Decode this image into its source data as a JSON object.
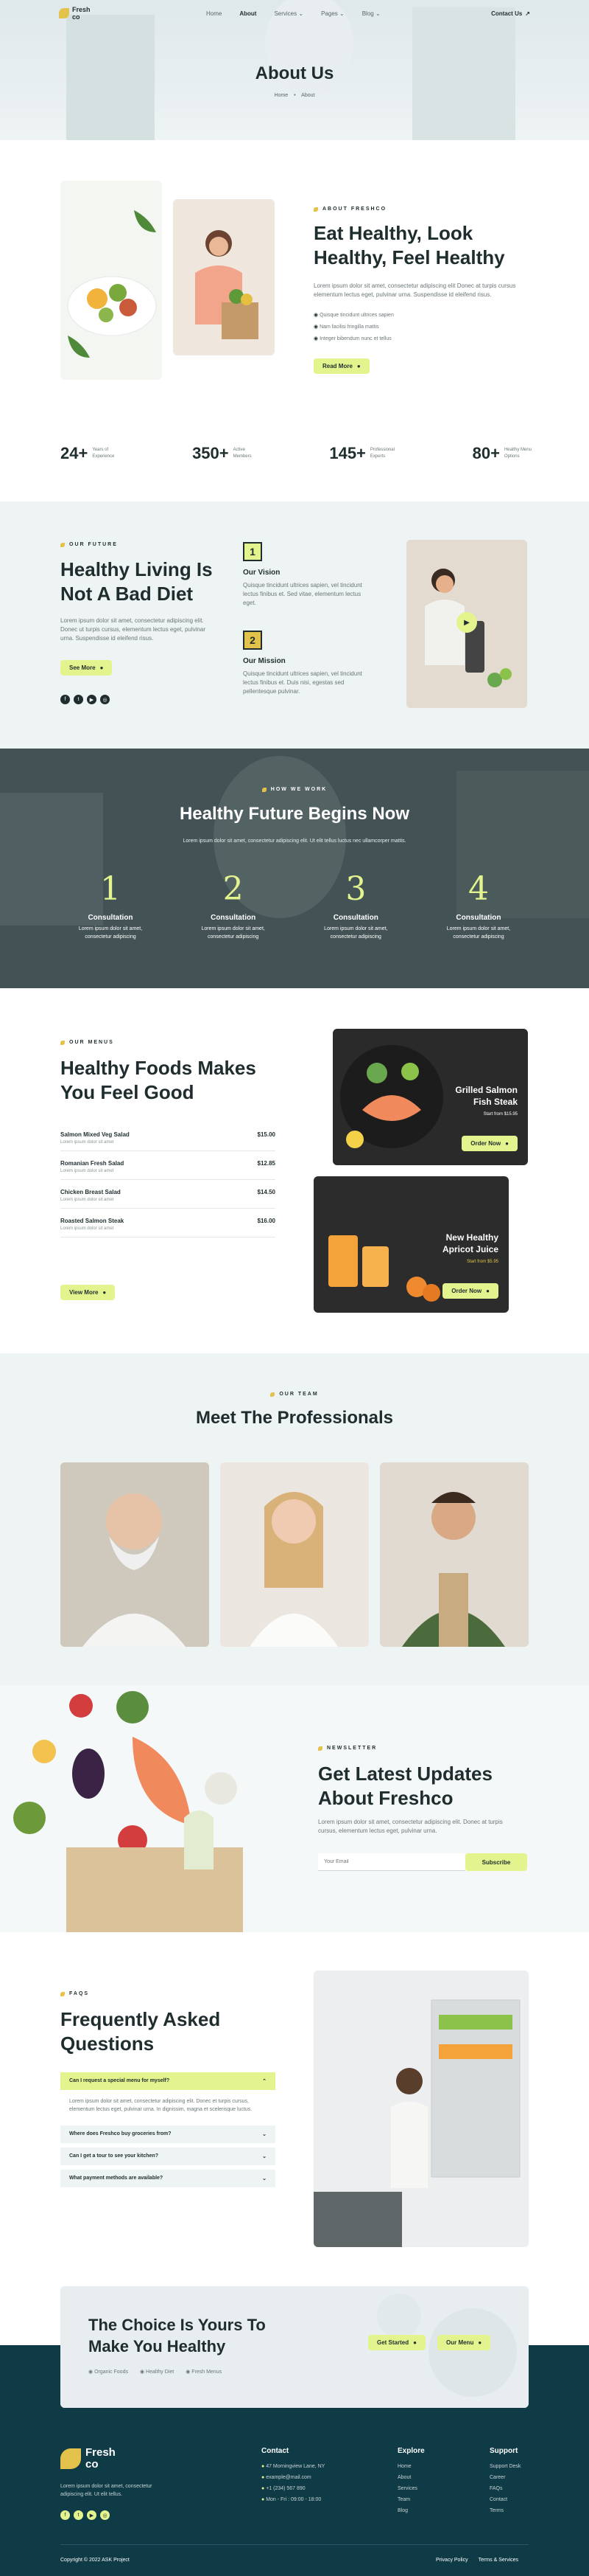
{
  "header": {
    "logo_line1": "Fresh",
    "logo_line2": "co",
    "nav": [
      {
        "label": "Home"
      },
      {
        "label": "About"
      },
      {
        "label": "Services"
      },
      {
        "label": "Pages"
      },
      {
        "label": "Blog"
      }
    ],
    "contact_label": "Contact Us"
  },
  "hero": {
    "title": "About Us",
    "breadcrumb_home": "Home",
    "breadcrumb_current": "About"
  },
  "about": {
    "label": "ABOUT FRESHCO",
    "title_line1": "Eat Healthy, Look",
    "title_line2": "Healthy, Feel Healthy",
    "text": "Lorem ipsum dolor sit amet, consectetur adipiscing elit Donec at turpis cursus elementum lectus eget, pulvinar urna. Suspendisse id eleifend risus.",
    "checks": [
      "Quisque tincidunt ultrices sapien",
      "Nam facilisi fringilla mattis",
      "Integer bibendum nunc et tellus"
    ],
    "button": "Read More"
  },
  "stats": [
    {
      "value": "24+",
      "label1": "Years of",
      "label2": "Experience"
    },
    {
      "value": "350+",
      "label1": "Active",
      "label2": "Members"
    },
    {
      "value": "145+",
      "label1": "Professional",
      "label2": "Experts"
    },
    {
      "value": "80+",
      "label1": "Healthy Menu",
      "label2": "Options"
    }
  ],
  "future": {
    "label": "OUR FUTURE",
    "title_line1": "Healthy Living Is",
    "title_line2": "Not A Bad Diet",
    "text": "Lorem ipsum dolor sit amet, consectetur adipiscing elit. Donec ut turpis cursus, elementum lectus eget, pulvinar urna. Suspendisse id eleifend risus.",
    "button": "See More",
    "vision_num": "1",
    "vision_title": "Our Vision",
    "vision_text": "Quisque tincidunt ultrices sapien, vel tincidunt lectus finibus et. Sed vitae, elementum lectus eget.",
    "mission_num": "2",
    "mission_title": "Our Mission",
    "mission_text": "Quisque tincidunt ultrices sapien, vel tincidunt lectus finibus et. Duis nisi, egestas sed pellentesque pulvinar."
  },
  "steps": {
    "label": "HOW WE WORK",
    "title": "Healthy Future Begins Now",
    "text": "Lorem ipsum dolor sit amet, consectetur adipiscing elit. Ut elit tellus luctus nec ullamcorper mattis.",
    "items": [
      {
        "num": "1",
        "title": "Consultation",
        "text1": "Lorem ipsum dolor sit amet,",
        "text2": "consectetur adipiscing"
      },
      {
        "num": "2",
        "title": "Consultation",
        "text1": "Lorem ipsum dolor sit amet,",
        "text2": "consectetur adipiscing"
      },
      {
        "num": "3",
        "title": "Consultation",
        "text1": "Lorem ipsum dolor sit amet,",
        "text2": "consectetur adipiscing"
      },
      {
        "num": "4",
        "title": "Consultation",
        "text1": "Lorem ipsum dolor sit amet,",
        "text2": "consectetur adipiscing"
      }
    ]
  },
  "menu": {
    "label": "OUR MENUS",
    "title_line1": "Healthy Foods Makes",
    "title_line2": "You Feel Good",
    "items": [
      {
        "name": "Salmon Mixed Veg Salad",
        "desc": "Lorem ipsum dolor sit amet",
        "price": "$15.00"
      },
      {
        "name": "Romanian Fresh Salad",
        "desc": "Lorem ipsum dolor sit amet",
        "price": "$12.85"
      },
      {
        "name": "Chicken Breast Salad",
        "desc": "Lorem ipsum dolor sit amet",
        "price": "$14.50"
      },
      {
        "name": "Roasted Salmon Steak",
        "desc": "Lorem ipsum dolor sit amet",
        "price": "$16.00"
      }
    ],
    "button": "View More",
    "card1_title1": "Grilled Salmon",
    "card1_title2": "Fish Steak",
    "card1_price": "Start from $15.95",
    "card1_button": "Order Now",
    "card2_title1": "New Healthy",
    "card2_title2": "Apricot Juice",
    "card2_price": "Start from $5.95",
    "card2_button": "Order Now"
  },
  "team": {
    "label": "OUR TEAM",
    "title": "Meet The Professionals"
  },
  "newsletter": {
    "label": "NEWSLETTER",
    "title_line1": "Get Latest Updates",
    "title_line2": "About Freshco",
    "text": "Lorem ipsum dolor sit amet, consectetur adipiscing elit. Donec at turpis cursus, elementum lectus eget, pulvinar urna.",
    "placeholder": "Your Email",
    "button": "Subscribe"
  },
  "faq": {
    "label": "FAQS",
    "title_line1": "Frequently Asked",
    "title_line2": "Questions",
    "open_question": "Can I request a special menu for myself?",
    "open_answer": "Lorem ipsum dolor sit amet, consectetur adipiscing elit. Donec et turpis cursus, elementum lectus eget, pulvinar urna. In dignissim, magna et scelerisque luctus.",
    "questions": [
      "Where does Freshco buy groceries from?",
      "Can I get a tour to see your kitchen?",
      "What payment methods are available?"
    ]
  },
  "cta": {
    "title_line1": "The Choice Is Yours To",
    "title_line2": "Make You Healthy",
    "checks": [
      "Organic Foods",
      "Healthy Diet",
      "Fresh Menus"
    ],
    "button1": "Get Started",
    "button2": "Our Menu"
  },
  "footer": {
    "logo_line1": "Fresh",
    "logo_line2": "co",
    "text1": "Lorem ipsum dolor sit amet, consectetur",
    "text2": "adipiscing elit. Ut elit tellus.",
    "contact_title": "Contact",
    "contact_items": [
      "47 Morningview Lane, NY",
      "example@mail.com",
      "+1 (234) 567 890",
      "Mon - Fri : 09:00 - 18:00"
    ],
    "explore_title": "Explore",
    "explore_items": [
      "Home",
      "About",
      "Services",
      "Team",
      "Blog"
    ],
    "support_title": "Support",
    "support_items": [
      "Support Desk",
      "Career",
      "FAQs",
      "Contact",
      "Terms"
    ],
    "copyright": "Copyright © 2022 ASK Project",
    "privacy": "Privacy Policy",
    "terms": "Terms & Services"
  },
  "colors": {
    "accent": "#e3f48e",
    "dark": "#1f2d2f",
    "teal": "#0f3b46",
    "gold": "#e3c24b"
  }
}
